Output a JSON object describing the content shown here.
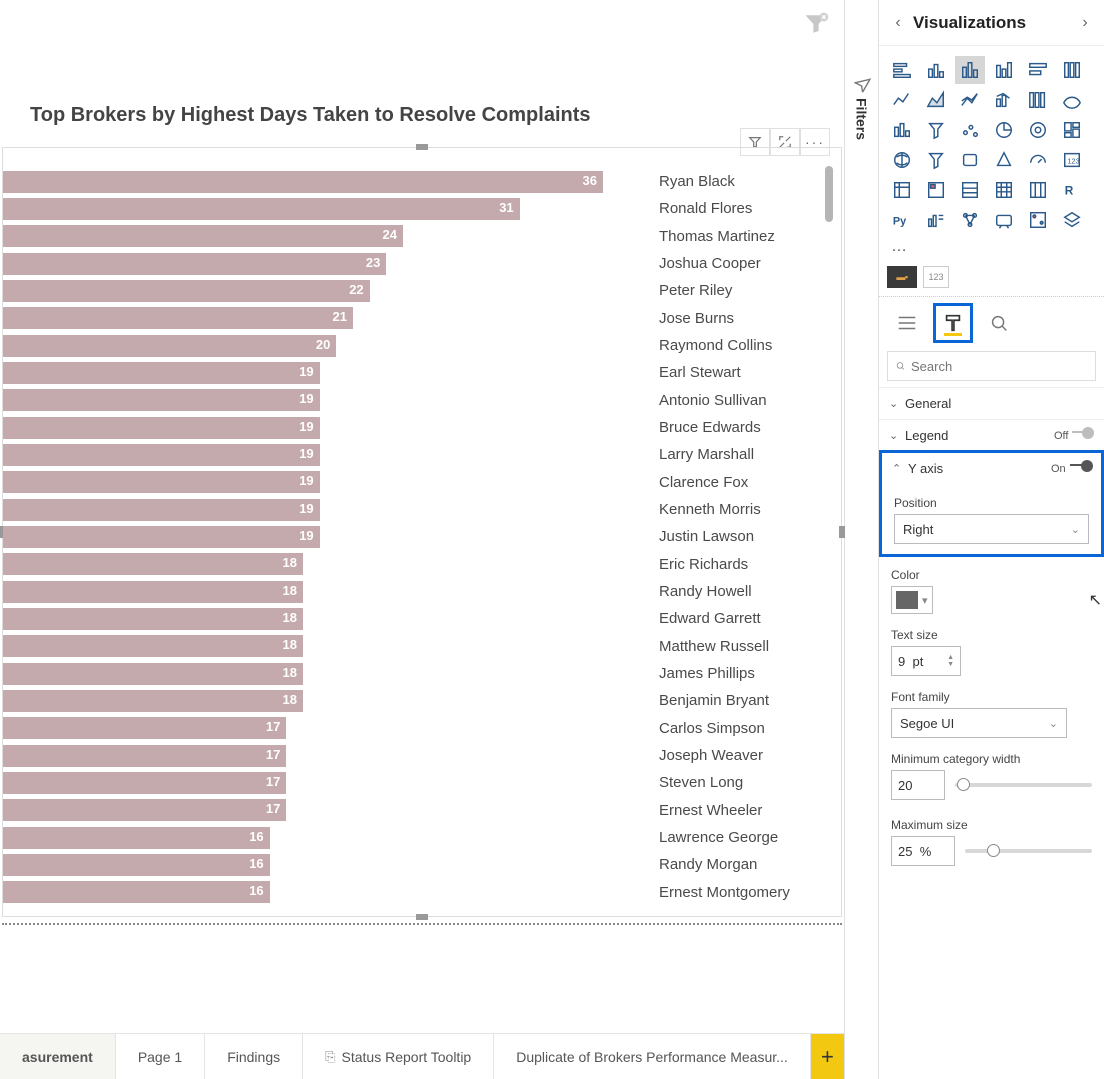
{
  "chart_data": {
    "type": "bar",
    "title": "Top Brokers by Highest Days Taken to Resolve Complaints",
    "categories": [
      "Ryan Black",
      "Ronald Flores",
      "Thomas Martinez",
      "Joshua Cooper",
      "Peter Riley",
      "Jose Burns",
      "Raymond Collins",
      "Earl Stewart",
      "Antonio Sullivan",
      "Bruce Edwards",
      "Larry Marshall",
      "Clarence Fox",
      "Kenneth Morris",
      "Justin Lawson",
      "Eric Richards",
      "Randy Howell",
      "Edward Garrett",
      "Matthew Russell",
      "James Phillips",
      "Benjamin Bryant",
      "Carlos Simpson",
      "Joseph Weaver",
      "Steven Long",
      "Ernest Wheeler",
      "Lawrence George",
      "Randy Morgan",
      "Ernest Montgomery"
    ],
    "values": [
      36,
      31,
      24,
      23,
      22,
      21,
      20,
      19,
      19,
      19,
      19,
      19,
      19,
      19,
      18,
      18,
      18,
      18,
      18,
      18,
      17,
      17,
      17,
      17,
      16,
      16,
      16
    ],
    "xlabel": "",
    "ylabel": "",
    "xlim": [
      0,
      36
    ]
  },
  "filters": {
    "panel_label": "Filters"
  },
  "viz_pane": {
    "title": "Visualizations",
    "more_glyph": "…",
    "search_placeholder": "Search",
    "field_wells": {
      "axis_hint": "▬▪",
      "value_hint": "123"
    },
    "sections": {
      "general": {
        "label": "General"
      },
      "legend": {
        "label": "Legend",
        "toggle_text": "Off",
        "on": false
      },
      "yaxis": {
        "label": "Y axis",
        "toggle_text": "On",
        "on": true,
        "position_label": "Position",
        "position_value": "Right",
        "color_label": "Color",
        "text_size_label": "Text size",
        "text_size_value": "9",
        "text_size_unit": "pt",
        "font_label": "Font family",
        "font_value": "Segoe UI",
        "min_cat_label": "Minimum category width",
        "min_cat_value": "20",
        "max_size_label": "Maximum size",
        "max_size_value": "25",
        "max_size_unit": "%"
      }
    }
  },
  "pages": {
    "tabs": [
      {
        "label": "asurement",
        "active": true
      },
      {
        "label": "Page 1"
      },
      {
        "label": "Findings"
      },
      {
        "label": "Status Report Tooltip",
        "pinned": true
      },
      {
        "label": "Duplicate of Brokers Performance Measur..."
      }
    ],
    "add_glyph": "+"
  }
}
